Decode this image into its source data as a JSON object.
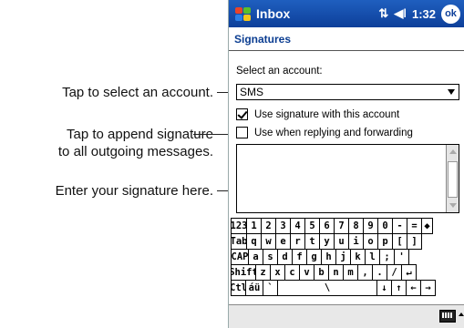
{
  "callouts": {
    "account": "Tap to select an account.",
    "append_line1": "Tap to append signature",
    "append_line2": "to all outgoing messages.",
    "signature": "Enter your signature here."
  },
  "titlebar": {
    "title": "Inbox",
    "connectivity_icon": "connectivity-icon",
    "volume_icon": "speaker-icon",
    "time": "1:32",
    "ok_label": "ok"
  },
  "page": {
    "heading": "Signatures",
    "account_label": "Select an account:",
    "account_value": "SMS",
    "use_signature_label": "Use signature with this account",
    "use_signature_checked": true,
    "replying_label": "Use when replying and forwarding",
    "replying_checked": false,
    "signature_text": ""
  },
  "keyboard": {
    "rows": [
      [
        "123",
        "1",
        "2",
        "3",
        "4",
        "5",
        "6",
        "7",
        "8",
        "9",
        "0",
        "-",
        "=",
        "◆"
      ],
      [
        "Tab",
        "q",
        "w",
        "e",
        "r",
        "t",
        "y",
        "u",
        "i",
        "o",
        "p",
        "[",
        "]"
      ],
      [
        "CAP",
        "a",
        "s",
        "d",
        "f",
        "g",
        "h",
        "j",
        "k",
        "l",
        ";",
        "'"
      ],
      [
        "Shift",
        "z",
        "x",
        "c",
        "v",
        "b",
        "n",
        "m",
        ",",
        ".",
        "/",
        "↵"
      ],
      [
        "Ctl",
        "áü",
        "`",
        "\\",
        "↓",
        "↑",
        "←",
        "→"
      ]
    ]
  },
  "bottombar": {
    "input_icon": "keyboard-icon",
    "arrow_icon": "up-arrow-icon"
  }
}
